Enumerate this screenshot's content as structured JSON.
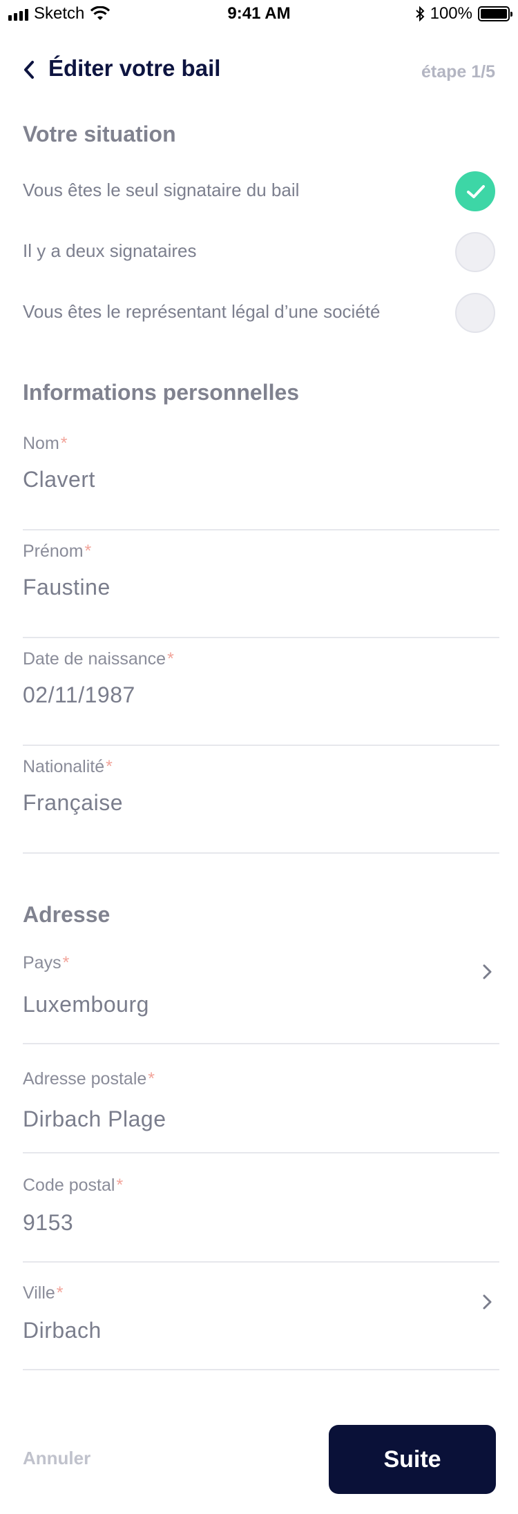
{
  "status_bar": {
    "carrier": "Sketch",
    "time": "9:41 AM",
    "battery": "100%"
  },
  "header": {
    "title": "Éditer votre bail",
    "step": "étape 1/5"
  },
  "situation": {
    "title": "Votre situation",
    "options": [
      {
        "label": "Vous êtes le seul signataire du bail",
        "selected": true
      },
      {
        "label": "Il y a deux signataires",
        "selected": false
      },
      {
        "label": "Vous êtes le représentant légal d’une société",
        "selected": false
      }
    ]
  },
  "personal": {
    "title": "Informations personnelles",
    "fields": [
      {
        "label": "Nom",
        "required": "*",
        "value": "Clavert"
      },
      {
        "label": "Prénom",
        "required": "*",
        "value": "Faustine"
      },
      {
        "label": "Date de naissance",
        "required": "*",
        "value": "02/11/1987"
      },
      {
        "label": "Nationalité",
        "required": "*",
        "value": "Française"
      }
    ]
  },
  "address": {
    "title": "Adresse",
    "fields": [
      {
        "label": "Pays",
        "required": "*",
        "value": "Luxembourg",
        "chevron": true
      },
      {
        "label": "Adresse postale",
        "required": "*",
        "value": "Dirbach Plage"
      },
      {
        "label": "Code postal",
        "required": "*",
        "value": "9153"
      },
      {
        "label": "Ville",
        "required": "*",
        "value": "Dirbach",
        "chevron": true
      }
    ]
  },
  "footer": {
    "cancel_label": "Annuler",
    "next_label": "Suite"
  },
  "colors": {
    "accent": "#3dd6a6",
    "primary": "#0a1138",
    "required": "#f2a49a"
  }
}
